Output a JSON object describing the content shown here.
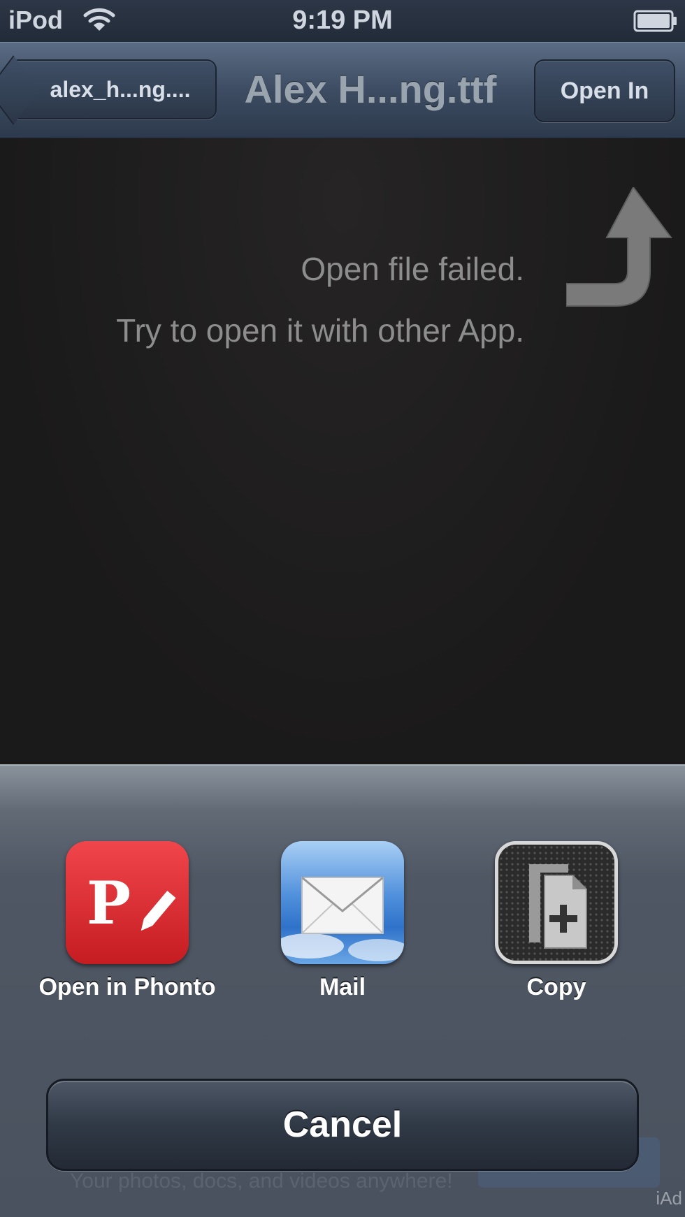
{
  "status_bar": {
    "carrier": "iPod",
    "time": "9:19 PM",
    "wifi_icon": "wifi-icon",
    "battery_icon": "battery-icon"
  },
  "nav_bar": {
    "back_label": "alex_h...ng....",
    "title": "Alex H...ng.ttf",
    "open_in_label": "Open In"
  },
  "content": {
    "line1": "Open file failed.",
    "line2": "Try to open it with other App.",
    "arrow_icon": "arrow-up-turn-icon"
  },
  "action_sheet": {
    "apps": [
      {
        "label": "Open in Phonto",
        "icon": "phonto-app-icon",
        "color": "#d9262c"
      },
      {
        "label": "Mail",
        "icon": "mail-app-icon",
        "color": "#4f8fdb"
      },
      {
        "label": "Copy",
        "icon": "copy-document-icon",
        "color": "#2b2b2b"
      }
    ],
    "cancel_label": "Cancel"
  },
  "ad_banner": {
    "text": "Your photos, docs, and videos anywhere!",
    "badge": "iAd"
  }
}
